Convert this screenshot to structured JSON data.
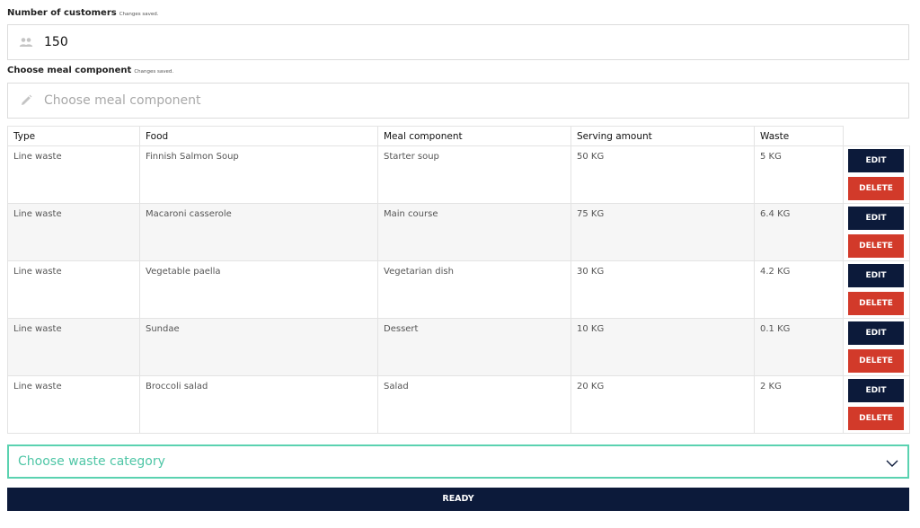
{
  "customers": {
    "label": "Number of customers",
    "saved": "Changes saved.",
    "value": "150",
    "icon": "people-icon"
  },
  "meal": {
    "label": "Choose meal component",
    "saved": "Changes saved.",
    "placeholder": "Choose meal component",
    "icon": "pencil-icon"
  },
  "table": {
    "headers": [
      "Type",
      "Food",
      "Meal component",
      "Serving amount",
      "Waste"
    ],
    "rows": [
      [
        "Line waste",
        "Finnish Salmon Soup",
        "Starter soup",
        "50 KG",
        "5 KG"
      ],
      [
        "Line waste",
        "Macaroni casserole",
        "Main course",
        "75 KG",
        "6.4 KG"
      ],
      [
        "Line waste",
        "Vegetable paella",
        "Vegetarian dish",
        "30 KG",
        "4.2 KG"
      ],
      [
        "Line waste",
        "Sundae",
        "Dessert",
        "10 KG",
        "0.1 KG"
      ],
      [
        "Line waste",
        "Broccoli salad",
        "Salad",
        "20 KG",
        "2 KG"
      ]
    ],
    "edit_label": "EDIT",
    "delete_label": "DELETE"
  },
  "waste_category": {
    "placeholder": "Choose waste category",
    "icon": "chevron-down-icon"
  },
  "ready_label": "READY",
  "colors": {
    "navy": "#0c1a3a",
    "red": "#d23a2a",
    "teal": "#5ad2b0"
  }
}
